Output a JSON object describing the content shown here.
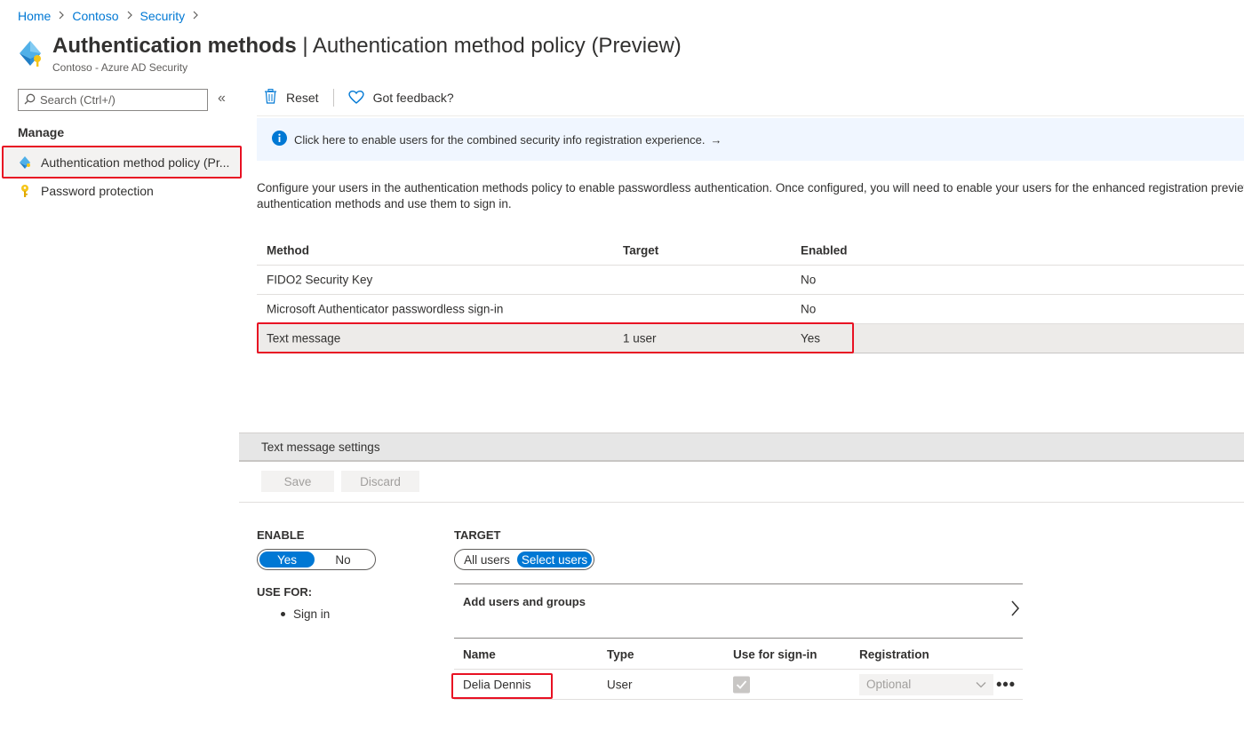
{
  "breadcrumb": {
    "items": [
      "Home",
      "Contoso",
      "Security"
    ],
    "separator": ">"
  },
  "header": {
    "title_bold": "Authentication methods",
    "title_rest": " | Authentication method policy (Preview)",
    "subtitle": "Contoso - Azure AD Security"
  },
  "sidebar": {
    "search_placeholder": "Search (Ctrl+/)",
    "collapse_glyph": "«",
    "section_label": "Manage",
    "items": [
      {
        "label": "Authentication method policy (Pr...",
        "icon": "auth-method-icon",
        "selected": true
      },
      {
        "label": "Password protection",
        "icon": "key-icon",
        "selected": false
      }
    ]
  },
  "toolbar": {
    "reset_label": "Reset",
    "feedback_label": "Got feedback?"
  },
  "info_banner": {
    "text": "Click here to enable users for the combined security info registration experience.",
    "arrow": "→"
  },
  "description": {
    "line1": "Configure your users in the authentication methods policy to enable passwordless authentication. Once configured, you will need to enable your users for the enhanced registration preview sc",
    "line2": "authentication methods and use them to sign in."
  },
  "methods_table": {
    "headers": [
      "Method",
      "Target",
      "Enabled"
    ],
    "rows": [
      {
        "method": "FIDO2 Security Key",
        "target": "",
        "enabled": "No"
      },
      {
        "method": "Microsoft Authenticator passwordless sign-in",
        "target": "",
        "enabled": "No"
      },
      {
        "method": "Text message",
        "target": "1 user",
        "enabled": "Yes"
      }
    ]
  },
  "settings": {
    "title": "Text message settings",
    "save_label": "Save",
    "discard_label": "Discard",
    "enable_label": "ENABLE",
    "enable_options": [
      "Yes",
      "No"
    ],
    "enable_selected": "Yes",
    "use_for_label": "USE FOR:",
    "use_for_items": [
      "Sign in"
    ],
    "target_label": "TARGET",
    "target_options": [
      "All users",
      "Select users"
    ],
    "target_selected": "Select users",
    "add_users_label": "Add users and groups",
    "users_table": {
      "headers": [
        "Name",
        "Type",
        "Use for sign-in",
        "Registration"
      ],
      "rows": [
        {
          "name": "Delia Dennis",
          "type": "User",
          "use_for_signin": true,
          "registration": "Optional"
        }
      ]
    },
    "more_glyph": "•••"
  },
  "colors": {
    "accent": "#0078d4",
    "highlight_box": "#e81123",
    "banner_bg": "#f0f6ff"
  }
}
